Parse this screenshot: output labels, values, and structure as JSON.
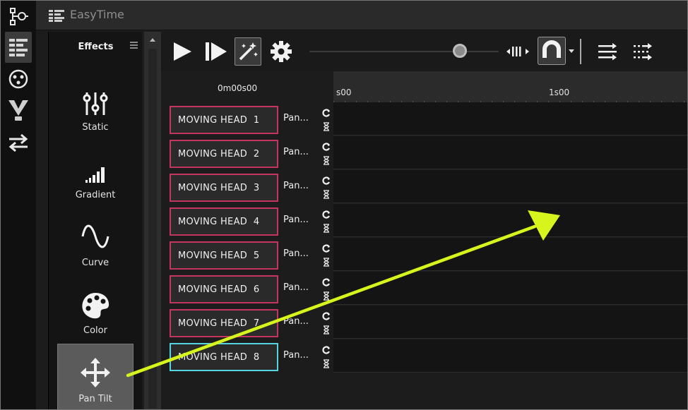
{
  "app": {
    "title": "EasyTime",
    "logo_icon": "timeline-logo-icon"
  },
  "iconbar": [
    {
      "name": "tree-nodes-icon",
      "active": false
    },
    {
      "name": "timeline-grid-icon",
      "active": true
    },
    {
      "name": "dmx-connector-icon",
      "active": false
    },
    {
      "name": "stage-light-icon",
      "active": false
    },
    {
      "name": "swap-arrows-icon",
      "active": false
    }
  ],
  "effects": {
    "header": "Effects",
    "items": [
      {
        "label": "Static",
        "icon": "sliders-icon"
      },
      {
        "label": "Gradient",
        "icon": "signal-bars-icon"
      },
      {
        "label": "Curve",
        "icon": "sine-wave-icon"
      },
      {
        "label": "Color",
        "icon": "palette-icon"
      },
      {
        "label": "Pan Tilt",
        "icon": "move-arrows-icon"
      }
    ],
    "selected": "Pan Tilt"
  },
  "toolbar": {
    "icons": [
      "play-icon",
      "play-from-start-icon",
      "magic-wand-icon",
      "gear-icon",
      "snap-bars-icon",
      "magnet-icon",
      "dropdown-icon",
      "align-right-icon",
      "align-dotted-icon"
    ],
    "zoom_slider": 0.77
  },
  "timeline": {
    "current_time": "0m00s00",
    "ruler_labels": [
      "s00",
      "1s00"
    ]
  },
  "rows": [
    {
      "fixture": "MOVING HEAD  1",
      "effect": "Pan...",
      "selected": false
    },
    {
      "fixture": "MOVING HEAD  2",
      "effect": "Pan...",
      "selected": false
    },
    {
      "fixture": "MOVING HEAD  3",
      "effect": "Pan...",
      "selected": false
    },
    {
      "fixture": "MOVING HEAD  4",
      "effect": "Pan...",
      "selected": false
    },
    {
      "fixture": "MOVING HEAD  5",
      "effect": "Pan...",
      "selected": false
    },
    {
      "fixture": "MOVING HEAD  6",
      "effect": "Pan...",
      "selected": false
    },
    {
      "fixture": "MOVING HEAD  7",
      "effect": "Pan...",
      "selected": false
    },
    {
      "fixture": "MOVING HEAD  8",
      "effect": "Pan...",
      "selected": true
    }
  ],
  "colors": {
    "fixture_border": "#c4365f",
    "fixture_selected_border": "#56d5e0",
    "annotation_arrow": "#d7f51c"
  }
}
